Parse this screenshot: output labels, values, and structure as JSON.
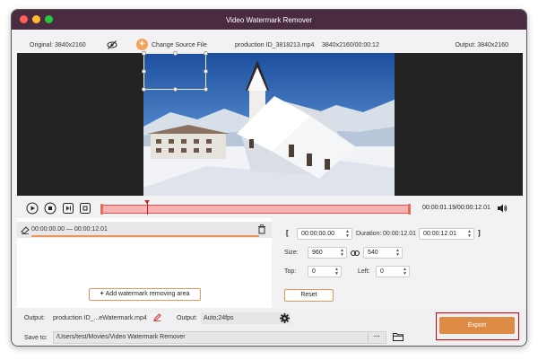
{
  "window": {
    "title": "Video Watermark Remover"
  },
  "info": {
    "original": "Original: 3840x2160",
    "change_source": "Change Source File",
    "filename": "production ID_3818213.mp4",
    "resolution_duration": "3840x2160/00:00:12",
    "output": "Output: 3840x2160"
  },
  "playback": {
    "timecode": "00:00:01.19/00:00:12.01"
  },
  "segment": {
    "range": "00:00:00.00 — 00:00:12.01"
  },
  "add_area_label": "Add watermark removing area",
  "range": {
    "start": "00:00:00.00",
    "duration_label": "Duration:",
    "duration": "00:00:12.01",
    "end": "00:00:12.01",
    "open_bracket": "[",
    "close_bracket": "]"
  },
  "size": {
    "label": "Size:",
    "width": "960",
    "height": "540"
  },
  "position": {
    "top_label": "Top:",
    "top": "0",
    "left_label": "Left:",
    "left": "0"
  },
  "reset_label": "Reset",
  "bottom": {
    "output_label": "Output:",
    "output_file": "production ID_...eWatermark.mp4",
    "output_format_label": "Output:",
    "output_format": "Auto;24fps",
    "save_to_label": "Save to:",
    "save_path": "/Users/test/Movies/Video Watermark Remover",
    "more": "···",
    "export_label": "Export"
  },
  "colors": {
    "titlebar": "#4a2c41",
    "accent": "#de8c45",
    "highlight": "#d40000"
  }
}
